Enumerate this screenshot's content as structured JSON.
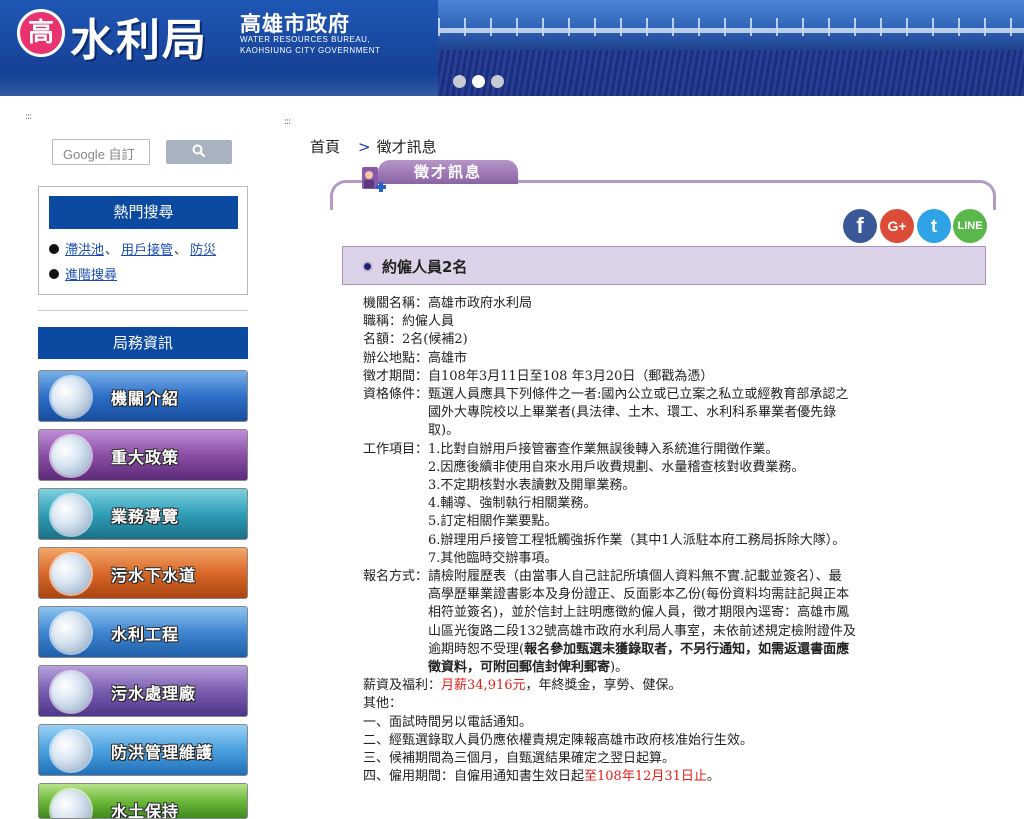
{
  "banner": {
    "logo_glyph": "高",
    "title": "水利局",
    "city": "高雄市政府",
    "english_line1": "WATER RESOURCES BUREAU,",
    "english_line2": "KAOHSIUNG CITY GOVERNMENT",
    "carousel_dots": 3,
    "carousel_active": 2
  },
  "sidebar": {
    "search_placeholder": "Google 自訂",
    "search_button_icon": "search-icon",
    "hot_search": {
      "title": "熱門搜尋",
      "links": [
        "滯洪池",
        "用戶接管",
        "防災"
      ],
      "separator": "、",
      "advanced": "進階搜尋"
    },
    "bureau_info_title": "局務資訊",
    "menu": [
      {
        "label": "機關介紹",
        "icon": "bureau-intro-icon"
      },
      {
        "label": "重大政策",
        "icon": "policy-quill-icon"
      },
      {
        "label": "業務導覽",
        "icon": "business-guide-icon"
      },
      {
        "label": "污水下水道",
        "icon": "sewer-icon"
      },
      {
        "label": "水利工程",
        "icon": "water-engineering-icon"
      },
      {
        "label": "污水處理廠",
        "icon": "treatment-plant-icon"
      },
      {
        "label": "防洪管理維護",
        "icon": "flood-control-icon"
      },
      {
        "label": "水土保持",
        "icon": "soil-conservation-icon"
      }
    ]
  },
  "breadcrumb": {
    "home": "首頁",
    "arrow": ">",
    "current": "徵才訊息"
  },
  "section_tab": "徵才訊息",
  "social": {
    "facebook": "f",
    "google_plus": "G+",
    "twitter": "t",
    "line": "LINE"
  },
  "job": {
    "title": "約僱人員2名",
    "lines": {
      "agency": "機關名稱：高雄市政府水利局",
      "position": "職稱：約僱人員",
      "quota": "名額：2名(候補2)",
      "location": "辦公地點：高雄市",
      "period": "徵才期間：自108年3月11日至108 年3月20日（郵戳為憑）"
    },
    "qualification": {
      "label": "資格條件：",
      "text": [
        "甄選人員應具下列條件之一者:國內公立或已立案之私立或經教育部承認之",
        "國外大專院校以上畢業者(具法律、土木、環工、水利科系畢業者優先錄",
        "取)。"
      ]
    },
    "work_items": {
      "label": "工作項目：",
      "items": [
        "1.比對自辦用戶接管審查作業無誤後轉入系統進行開徵作業。",
        "2.因應後續非使用自來水用戶收費規劃、水量稽查核對收費業務。",
        "3.不定期核對水表讀數及開單業務。",
        "4.輔導、強制執行相關業務。",
        "5.訂定相關作業要點。",
        "6.辦理用戶接管工程牴觸強拆作業（其中1人派駐本府工務局拆除大隊）。",
        "7.其他臨時交辦事項。"
      ]
    },
    "application": {
      "label": "報名方式：",
      "text": [
        "請檢附履歷表（由當事人自己註記所填個人資料無不實.記載並簽名）、最",
        "高學歷畢業證書影本及身份證正、反面影本乙份(每份資料均需註記與正本",
        "相符並簽名)，並於信封上註明應徵約僱人員，徵才期限內逕寄：高雄市鳳",
        "山區光復路二段132號高雄市政府水利局人事室，未依前述規定檢附證件及",
        "逾期時恕不受理("
      ],
      "bold_part1": "報名參加甄選未獲錄取者，不另行通知，如需返還書面應",
      "bold_part2": "徵資料，可附回郵信封俾利郵寄",
      "tail": ")。"
    },
    "salary": {
      "label": "薪資及福利：",
      "amount": "月薪34,916元",
      "rest": "，年終獎金，享勞、健保。"
    },
    "others_label": "其他：",
    "others": [
      "一、面試時間另以電話通知。",
      "二、經甄選錄取人員仍應依權責規定陳報高雄市政府核准始行生效。",
      "三、候補期間為三個月，自甄選結果確定之翌日起算。"
    ],
    "employment": {
      "prefix": "四、僱用期間：自僱用通知書生效日起",
      "red": "至108年12月31日止",
      "suffix": "。"
    }
  },
  "colors": {
    "nav_blue": "#0b4aa0",
    "tab_purple": "#8b63a5",
    "header_lavender": "#ddd3e8",
    "emphasis_red": "#e0201a"
  }
}
